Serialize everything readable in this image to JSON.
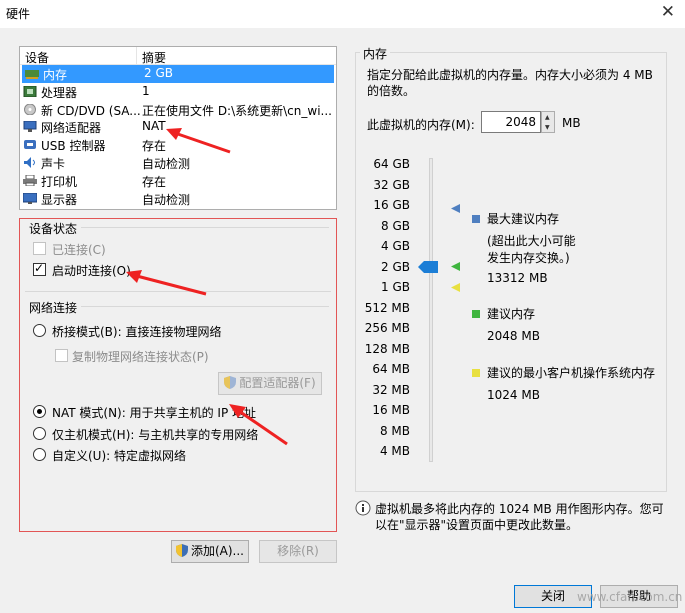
{
  "window": {
    "title": "硬件"
  },
  "device_list": {
    "headers": {
      "device": "设备",
      "summary": "摘要"
    },
    "rows": [
      {
        "name": "内存",
        "summary": "2 GB",
        "icon": "memory-icon",
        "selected": true
      },
      {
        "name": "处理器",
        "summary": "1",
        "icon": "cpu-icon"
      },
      {
        "name": "新 CD/DVD (SA...",
        "summary": "正在使用文件 D:\\系统更新\\cn_wi...",
        "icon": "disc-icon"
      },
      {
        "name": "网络适配器",
        "summary": "NAT",
        "icon": "network-icon"
      },
      {
        "name": "USB 控制器",
        "summary": "存在",
        "icon": "usb-icon"
      },
      {
        "name": "声卡",
        "summary": "自动检测",
        "icon": "speaker-icon"
      },
      {
        "name": "打印机",
        "summary": "存在",
        "icon": "printer-icon"
      },
      {
        "name": "显示器",
        "summary": "自动检测",
        "icon": "monitor-icon"
      }
    ]
  },
  "device_status": {
    "title": "设备状态",
    "connected": "已连接(C)",
    "connect_on_start": "启动时连接(O)"
  },
  "network": {
    "title": "网络连接",
    "bridged": "桥接模式(B): 直接连接物理网络",
    "replicate": "复制物理网络连接状态(P)",
    "config_button": "配置适配器(F)",
    "nat": "NAT 模式(N): 用于共享主机的 IP 地址",
    "host_only": "仅主机模式(H): 与主机共享的专用网络",
    "custom": "自定义(U): 特定虚拟网络"
  },
  "buttons": {
    "add": "添加(A)...",
    "remove": "移除(R)",
    "close": "关闭",
    "help": "帮助"
  },
  "memory": {
    "section": "内存",
    "description": "指定分配给此虚拟机的内存量。内存大小必须为 4 MB 的倍数。",
    "label": "此虚拟机的内存(M):",
    "value": "2048",
    "unit": "MB",
    "ticks": [
      "64 GB",
      "32 GB",
      "16 GB",
      "8 GB",
      "4 GB",
      "2 GB",
      "1 GB",
      "512 MB",
      "256 MB",
      "128 MB",
      "64 MB",
      "32 MB",
      "16 MB",
      "8 MB",
      "4 MB"
    ],
    "legend": {
      "max_label": "最大建议内存",
      "max_note": "(超出此大小可能\n发生内存交换。)",
      "max_value": "13312 MB",
      "rec_label": "建议内存",
      "rec_value": "2048 MB",
      "min_label": "建议的最小客户机操作系统内存",
      "min_value": "1024 MB"
    },
    "colors": {
      "max": "#4f7fc0",
      "rec": "#3fb53f",
      "min": "#e8e040",
      "thumb": "#1c7ed6"
    },
    "info": "虚拟机最多将此内存的 1024 MB 用作图形内存。您可以在\"显示器\"设置页面中更改此数量。"
  },
  "watermark": "www.cfan.com.cn"
}
